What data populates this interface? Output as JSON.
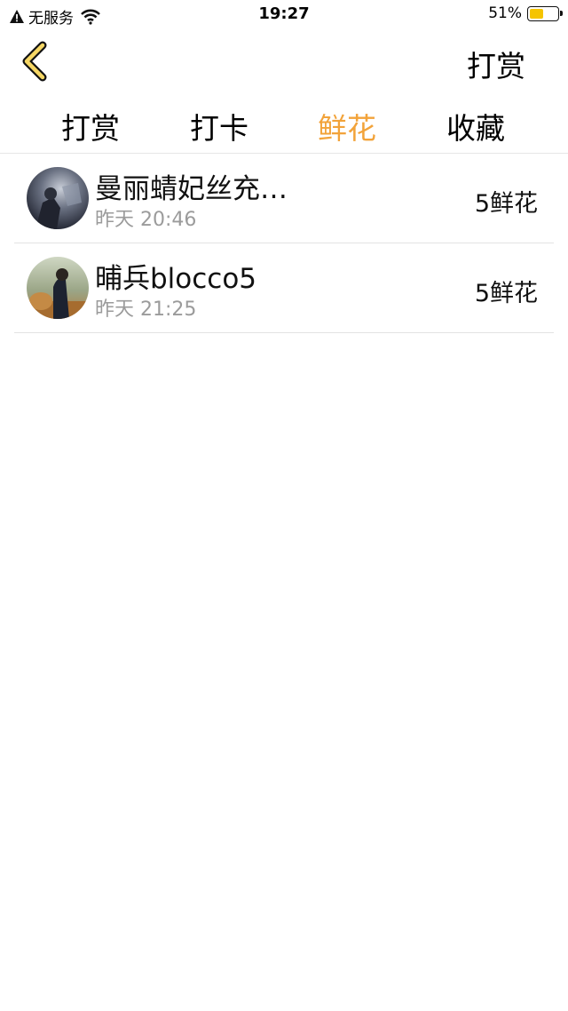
{
  "status_bar": {
    "carrier": "无服务",
    "time": "19:27",
    "battery_percent": "51%",
    "battery_level": 0.51,
    "battery_color": "#f5c400"
  },
  "nav": {
    "back_icon": "chevron-left-icon",
    "right_label": "打赏"
  },
  "tabs": [
    {
      "label": "打赏",
      "active": false
    },
    {
      "label": "打卡",
      "active": false
    },
    {
      "label": "鲜花",
      "active": true
    },
    {
      "label": "收藏",
      "active": false
    }
  ],
  "accent_color": "#f2a33a",
  "list": [
    {
      "name": "曼丽蜻妃丝充…",
      "time": "昨天 20:46",
      "amount": "5鲜花"
    },
    {
      "name": "晡兵blocco5",
      "time": "昨天 21:25",
      "amount": "5鲜花"
    }
  ]
}
